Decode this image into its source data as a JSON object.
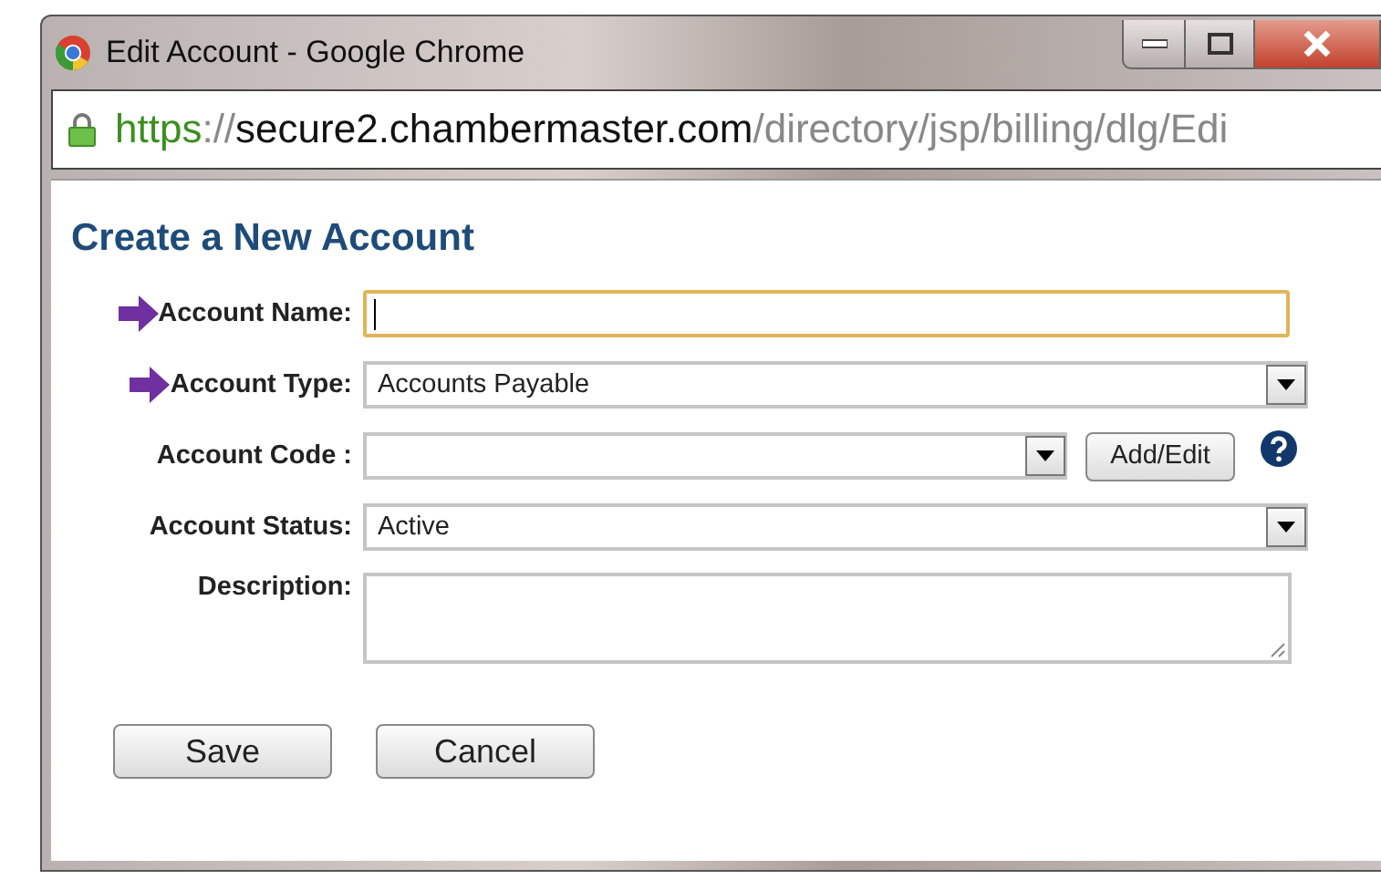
{
  "window": {
    "title": "Edit Account - Google Chrome"
  },
  "address_bar": {
    "secure": true,
    "scheme": "https",
    "separator": "://",
    "host": "secure2.chambermaster.com",
    "path": "/directory/jsp/billing/dlg/Edi"
  },
  "heading": "Create a New Account",
  "fields": [
    {
      "kind": "text",
      "label": "Account Name:",
      "marked": true,
      "focused": true
    },
    {
      "kind": "select",
      "label": "Account Type:",
      "value": "Accounts Payable",
      "marked": true,
      "focused": false
    },
    {
      "kind": "select_button",
      "label": "Account Code :",
      "button": "Add/Edit",
      "help": true,
      "marked": false,
      "focused": false
    },
    {
      "kind": "select",
      "label": "Account Status:",
      "value": "Active",
      "marked": false,
      "focused": false
    },
    {
      "kind": "textarea",
      "label": "Description:",
      "marked": false,
      "focused": false
    }
  ],
  "buttons": [
    "Save",
    "Cancel"
  ]
}
